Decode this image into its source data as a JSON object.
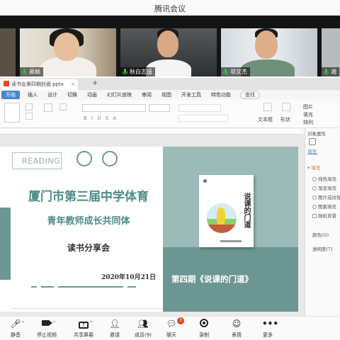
{
  "window": {
    "title": "腾讯会议"
  },
  "participants": [
    {
      "name": "蔺颖"
    },
    {
      "name": "秋白志遥"
    },
    {
      "name": "邬文杰"
    },
    {
      "name": "湘"
    }
  ],
  "ppt": {
    "file_tab": "读书会第四期封面.pptx",
    "new_tab": "+",
    "ribbon_tabs": [
      "开始",
      "插入",
      "设计",
      "切换",
      "动画",
      "幻灯片放映",
      "审阅",
      "视图",
      "开发工具",
      "特色功能"
    ],
    "search_label": "查找",
    "toolbar": {
      "font_sample": "B I U S A",
      "text_box": "文本框",
      "shape": "形状",
      "arrange": "排列",
      "picture": "图片",
      "fill": "填充"
    }
  },
  "slide": {
    "reading": "READING",
    "title": "厦门市第三届中学体育",
    "subtitle": "青年教师成长共同体",
    "event": "读书分享会",
    "date": "2020年10月21日",
    "issue": "第四期《说课的门道》",
    "book_title": "说课的门道"
  },
  "panel": {
    "header": "对象属性",
    "tab_fill": "填充",
    "section": "填充",
    "options": [
      "纯色填充",
      "渐变填充",
      "图片或纹理",
      "图案填充",
      "随机背景"
    ],
    "color_label": "颜色(O)",
    "transparency_label": "透明度(T)"
  },
  "bottombar": {
    "items": [
      {
        "label": "静音",
        "icon": "mic-icon"
      },
      {
        "label": "停止视频",
        "icon": "camera-icon"
      },
      {
        "label": "共享屏幕",
        "icon": "share-screen-icon"
      },
      {
        "label": "邀请",
        "icon": "invite-icon"
      },
      {
        "label": "成员(9)",
        "icon": "members-icon"
      },
      {
        "label": "聊天",
        "icon": "chat-icon",
        "badge": "3"
      },
      {
        "label": "录制",
        "icon": "record-icon"
      },
      {
        "label": "表情",
        "icon": "emoji-icon"
      },
      {
        "label": "更多",
        "icon": "more-icon"
      }
    ]
  },
  "colors": {
    "teal": "#6b9691",
    "teal_light": "#9bbbb7",
    "title_teal": "#4e8b87",
    "accent_blue": "#4a86c8",
    "badge_red": "#e8402b"
  }
}
